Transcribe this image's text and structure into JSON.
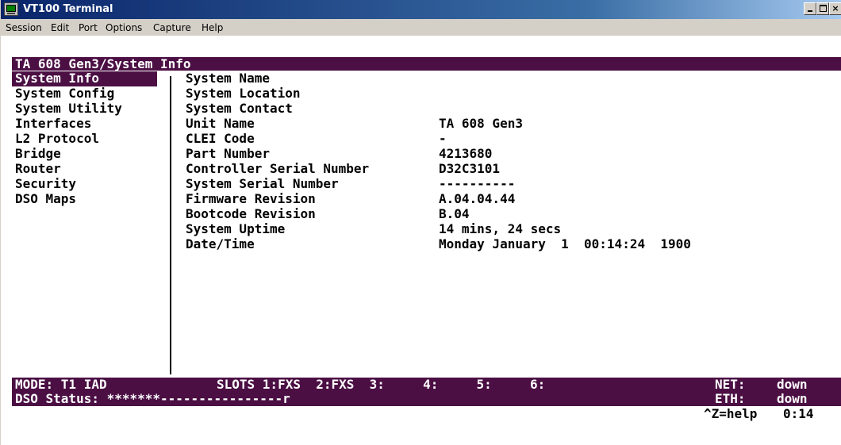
{
  "window": {
    "title": "VT100 Terminal",
    "controls": {
      "minimize": "_",
      "maximize": "□",
      "close": "×"
    }
  },
  "menubar": {
    "items": [
      "Session",
      "Edit",
      "Port",
      "Options",
      "Capture",
      "Help"
    ]
  },
  "terminal": {
    "breadcrumb": "TA 608 Gen3/System Info",
    "menu": [
      "System Info",
      "System Config",
      "System Utility",
      "Interfaces",
      "L2 Protocol",
      "Bridge",
      "Router",
      "Security",
      "DSO Maps"
    ],
    "fields": [
      {
        "label": "System Name",
        "value": ""
      },
      {
        "label": "System Location",
        "value": ""
      },
      {
        "label": "System Contact",
        "value": ""
      },
      {
        "label": "Unit Name",
        "value": "TA 608 Gen3"
      },
      {
        "label": "CLEI Code",
        "value": "-"
      },
      {
        "label": "Part Number",
        "value": "4213680"
      },
      {
        "label": "Controller Serial Number",
        "value": "D32C3101"
      },
      {
        "label": "System Serial Number",
        "value": "----------"
      },
      {
        "label": "Firmware Revision",
        "value": "A.04.04.44"
      },
      {
        "label": "Bootcode Revision",
        "value": "B.04"
      },
      {
        "label": "System Uptime",
        "value": "14 mins, 24 secs"
      },
      {
        "label": "Date/Time",
        "value": "Monday January  1  00:14:24  1900"
      }
    ],
    "status": {
      "mode": "MODE: T1 IAD",
      "slots": "SLOTS 1:FXS  2:FXS  3:     4:     5:     6:",
      "net_label": "NET:",
      "net_value": "down",
      "dso_status": "DSO Status: *******----------------r",
      "eth_label": "ETH:",
      "eth_value": "down",
      "help": "^Z=help",
      "clock": "0:14"
    },
    "colors": {
      "highlight": "#4b0f44",
      "foreground": "#000000",
      "background": "#ffffff"
    }
  }
}
